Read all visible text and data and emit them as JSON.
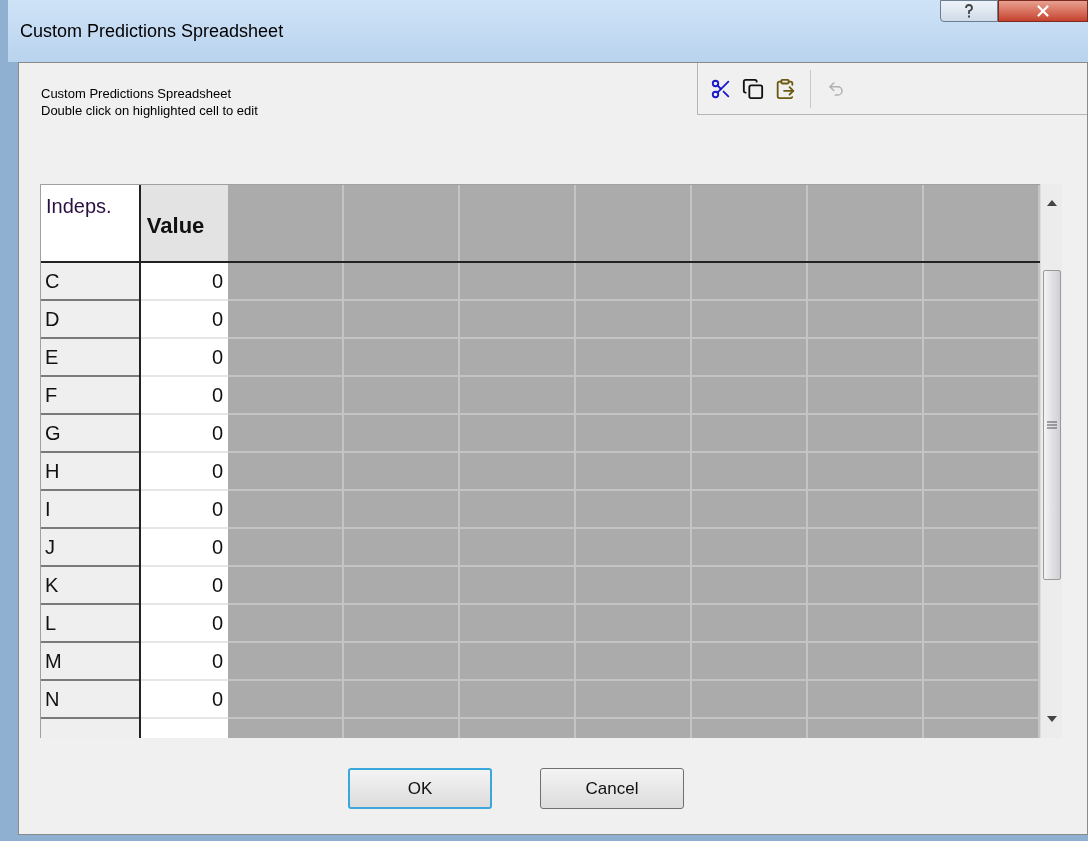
{
  "window": {
    "title": "Custom Predictions Spreadsheet"
  },
  "instructions": [
    "Custom Predictions Spreadsheet",
    "Double click on highlighted cell to edit"
  ],
  "toolbar": [
    {
      "kind": "cut",
      "disabled": false
    },
    {
      "kind": "copy",
      "disabled": false
    },
    {
      "kind": "paste",
      "disabled": false
    },
    {
      "kind": "undo",
      "disabled": true
    }
  ],
  "table": {
    "columns": [
      "Indeps.",
      "Value"
    ],
    "rows": [
      {
        "label": "C",
        "value": "0"
      },
      {
        "label": "D",
        "value": "0"
      },
      {
        "label": "E",
        "value": "0"
      },
      {
        "label": "F",
        "value": "0"
      },
      {
        "label": "G",
        "value": "0"
      },
      {
        "label": "H",
        "value": "0"
      },
      {
        "label": "I",
        "value": "0"
      },
      {
        "label": "J",
        "value": "0"
      },
      {
        "label": "K",
        "value": "0"
      },
      {
        "label": "L",
        "value": "0"
      },
      {
        "label": "M",
        "value": "0"
      },
      {
        "label": "N",
        "value": "0"
      }
    ]
  },
  "buttons": [
    {
      "label": "OK",
      "default": true
    },
    {
      "label": "Cancel",
      "default": false
    }
  ]
}
